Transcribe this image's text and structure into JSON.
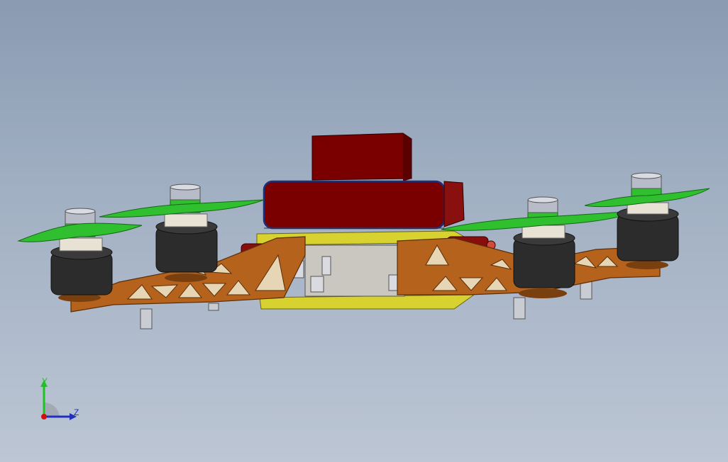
{
  "viewport": {
    "background_top": "#8a9bb2",
    "background_bottom": "#bcc6d4"
  },
  "model": {
    "colors": {
      "frame": "#b5621c",
      "frame_dark": "#7a3f0f",
      "plate": "#d8d231",
      "battery": "#7a0000",
      "battery_outline": "#1d2f7a",
      "motor": "#2c2c2c",
      "propeller": "#2fbf2f",
      "motor_cap": "#b8bcc8",
      "standoff": "#c9ccd3"
    },
    "motor_count": 4
  },
  "triad": {
    "y_label": "Y",
    "z_label": "Z",
    "y_color": "#1ec41e",
    "z_color": "#1f2fbf",
    "origin_color": "#d01010"
  }
}
